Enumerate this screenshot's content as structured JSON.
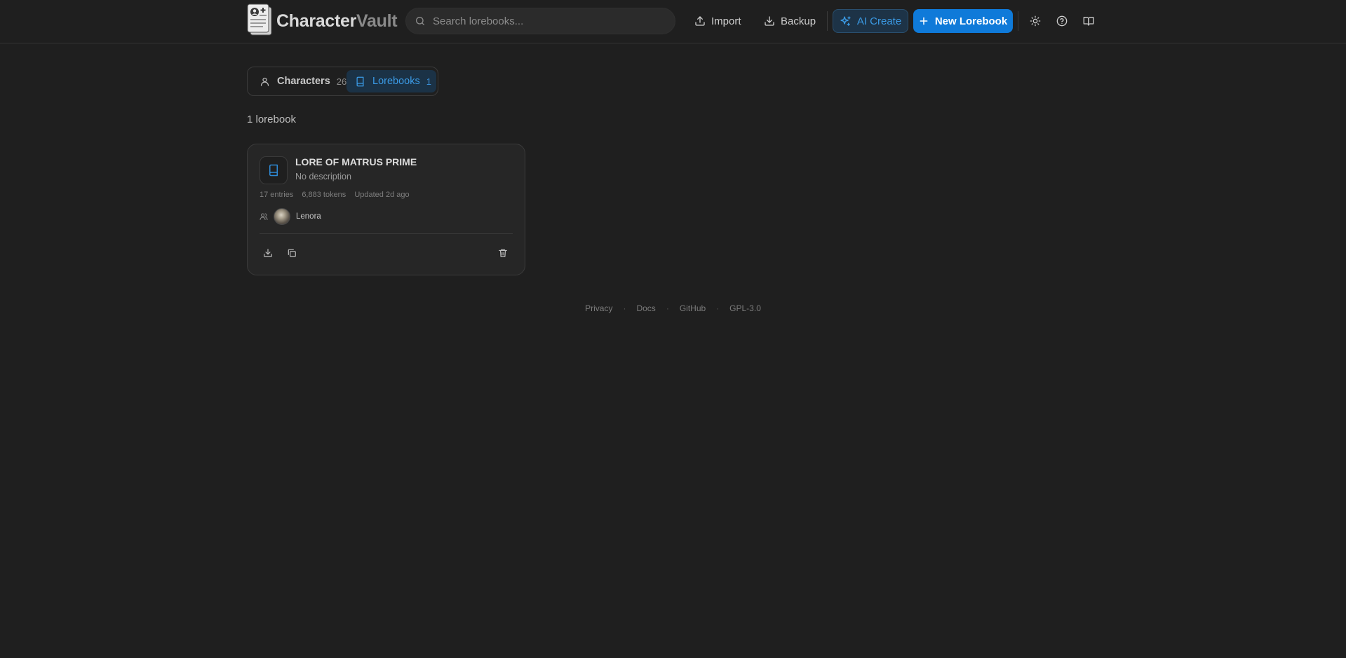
{
  "header": {
    "logo": {
      "primary": "Character",
      "secondary": "Vault"
    },
    "search_placeholder": "Search lorebooks...",
    "import_label": "Import",
    "backup_label": "Backup",
    "ai_create_label": "AI Create",
    "new_lorebook_label": "New Lorebook",
    "icons": [
      "theme-sun-icon",
      "help-icon",
      "docs-book-icon"
    ]
  },
  "tabs": [
    {
      "label": "Characters",
      "count": "26",
      "icon": "user-icon",
      "active": false
    },
    {
      "label": "Lorebooks",
      "count": "1",
      "icon": "book-icon",
      "active": true
    }
  ],
  "results_count": "1 lorebook",
  "lorebooks": [
    {
      "title": "LORE OF MATRUS PRIME",
      "description": "No description",
      "entries": "17 entries",
      "tokens": "6,883 tokens",
      "updated": "Updated 2d ago",
      "linked_character": "Lenora",
      "actions": [
        "download-icon",
        "duplicate-icon",
        "delete-icon"
      ]
    }
  ],
  "footer": {
    "links": [
      "Privacy",
      "Docs",
      "GitHub",
      "GPL-3.0"
    ],
    "separator": "·"
  },
  "colors": {
    "background": "#1f1f1f",
    "accent": "#0f7ad9",
    "accent_text": "#3b9be6"
  }
}
